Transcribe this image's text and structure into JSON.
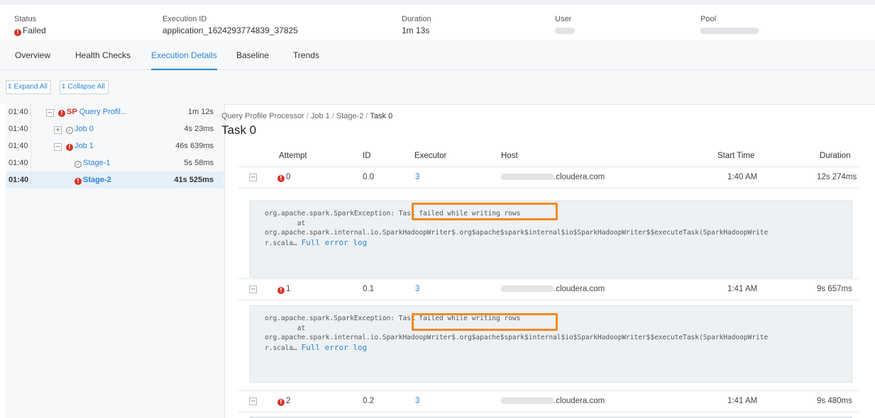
{
  "summary": {
    "status_label": "Status",
    "status_value": "Failed",
    "execution_label": "Execution ID",
    "execution_value": "application_1624293774839_37825",
    "duration_label": "Duration",
    "duration_value": "1m 13s",
    "user_label": "User",
    "pool_label": "Pool"
  },
  "tabs": [
    "Overview",
    "Health Checks",
    "Execution Details",
    "Baseline",
    "Trends"
  ],
  "active_tab": "Execution Details",
  "toolbar": {
    "expand_all": "Expand All",
    "collapse_all": "Collapse All"
  },
  "tree": [
    {
      "time": "01:40",
      "badge": "SP",
      "label": "Query Profil...",
      "duration": "1m 12s",
      "status": "error",
      "toggle": "minus"
    },
    {
      "time": "01:40",
      "label": "Job 0",
      "duration": "4s 23ms",
      "status": "ok",
      "toggle": "plus"
    },
    {
      "time": "01:40",
      "label": "Job 1",
      "duration": "46s 639ms",
      "status": "error",
      "toggle": "minus"
    },
    {
      "time": "01:40",
      "label": "Stage-1",
      "duration": "5s 58ms",
      "status": "ok"
    },
    {
      "time": "01:40",
      "label": "Stage-2",
      "duration": "41s 525ms",
      "status": "error",
      "selected": true
    }
  ],
  "breadcrumb": [
    "Query Profile Processor",
    "Job 1",
    "Stage-2",
    "Task 0"
  ],
  "page_title": "Task 0",
  "table": {
    "columns": [
      "Attempt",
      "ID",
      "Executor",
      "Host",
      "Start Time",
      "Duration"
    ],
    "rows": [
      {
        "attempt": "0",
        "id": "0.0",
        "executor": "3",
        "host": ".cloudera.com",
        "start": "1:40 AM",
        "duration": "12s 274ms"
      },
      {
        "attempt": "1",
        "id": "0.1",
        "executor": "3",
        "host": ".cloudera.com",
        "start": "1:41 AM",
        "duration": "9s 657ms"
      },
      {
        "attempt": "2",
        "id": "0.2",
        "executor": "3",
        "host": ".cloudera.com",
        "start": "1:41 AM",
        "duration": "9s 480ms"
      }
    ]
  },
  "error": {
    "exception": "org.apache.spark.SparkException:",
    "message": "Task failed while writing rows",
    "at": "at",
    "trace_line": "org.apache.spark.internal.io.SparkHadoopWriter$.org$apache$spark$internal$io$SparkHadoopWriter$$executeTask(SparkHadoopWrite",
    "trace_tail": "r.scala…",
    "full_log_link": "Full error log"
  },
  "colors": {
    "accent": "#2b84d9",
    "error": "#d93025",
    "highlight": "#f08a24"
  }
}
